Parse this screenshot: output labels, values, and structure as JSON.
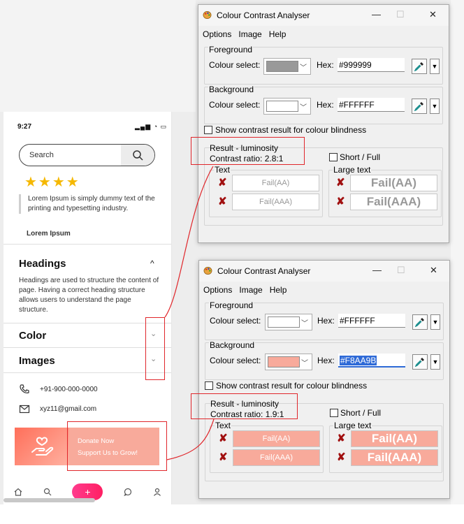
{
  "phone": {
    "time": "9:27",
    "status_icons": "▂▄▆ ◔ ▭",
    "search_placeholder": "Search",
    "stars": "★★★★",
    "quote": "Lorem Ipsum is simply dummy text of the printing and typesetting industry.",
    "quote_author": "Lorem Ipsum",
    "accordion": [
      {
        "title": "Headings",
        "toggle": "^",
        "body": "Headings are used to structure the content of page. Having a correct heading structure allows users to understand the page structure."
      },
      {
        "title": "Color",
        "toggle": "⌄"
      },
      {
        "title": "Images",
        "toggle": "⌄"
      }
    ],
    "phone_number": "+91-900-000-0000",
    "email": "xyz11@gmail.com",
    "donate_line1": "Donate Now",
    "donate_line2": "Support Us to Grow!",
    "nav_add": "+",
    "colors": {
      "donate_bg": "#F8AA9B",
      "star": "#F5B800",
      "nav_add": "#FF2D77"
    }
  },
  "windows": [
    {
      "title": "Colour Contrast Analyser",
      "menu": [
        "Options",
        "Image",
        "Help"
      ],
      "foreground_label": "Foreground",
      "foreground_select_label": "Colour select:",
      "foreground_color": "#999999",
      "hex_label": "Hex:",
      "foreground_hex": "#999999",
      "background_label": "Background",
      "background_select_label": "Colour select:",
      "background_color": "#FFFFFF",
      "background_hex": "#FFFFFF",
      "blindness_label": "Show contrast result for colour blindness",
      "result_label": "Result - luminosity",
      "contrast_ratio": "Contrast ratio: 2.8:1",
      "short_full": "Short / Full",
      "text_label": "Text",
      "large_text_label": "Large text",
      "text_aa": "Fail(AA)",
      "text_aaa": "Fail(AAA)",
      "large_aa": "Fail(AA)",
      "large_aaa": "Fail(AAA)",
      "fail_text_color": "#999999",
      "fail_bg_color": "#FFFFFF"
    },
    {
      "title": "Colour Contrast Analyser",
      "menu": [
        "Options",
        "Image",
        "Help"
      ],
      "foreground_label": "Foreground",
      "foreground_select_label": "Colour select:",
      "foreground_color": "#FFFFFF",
      "hex_label": "Hex:",
      "foreground_hex": "#FFFFFF",
      "background_label": "Background",
      "background_select_label": "Colour select:",
      "background_color": "#F8AA9B",
      "background_hex": "#F8AA9B",
      "blindness_label": "Show contrast result for colour blindness",
      "result_label": "Result - luminosity",
      "contrast_ratio": "Contrast ratio: 1.9:1",
      "short_full": "Short / Full",
      "text_label": "Text",
      "large_text_label": "Large text",
      "text_aa": "Fail(AA)",
      "text_aaa": "Fail(AAA)",
      "large_aa": "Fail(AA)",
      "large_aaa": "Fail(AAA)",
      "fail_text_color": "#FFFFFF",
      "fail_bg_color": "#F8AA9B"
    }
  ],
  "annotation_color": "#E0262B"
}
